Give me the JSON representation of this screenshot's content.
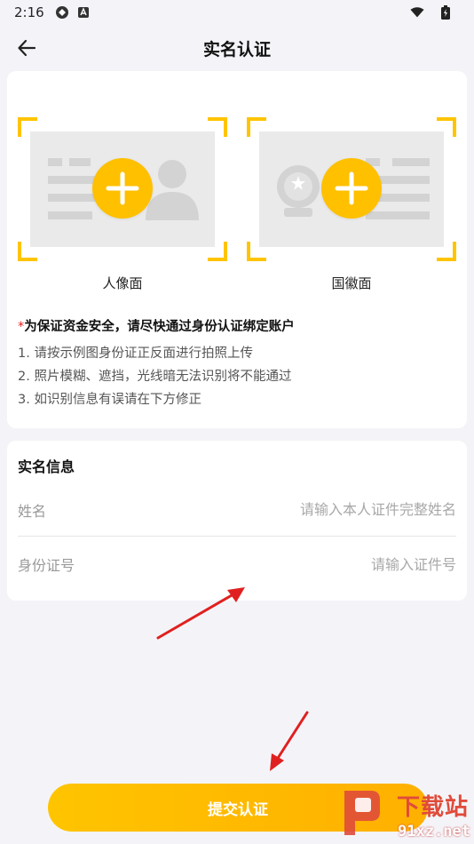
{
  "status_bar": {
    "time": "2:16"
  },
  "header": {
    "title": "实名认证"
  },
  "id_upload": {
    "front_label": "人像面",
    "back_label": "国徽面"
  },
  "notice": {
    "headline_star": "*",
    "headline": "为保证资金安全，请尽快通过身份认证绑定账户",
    "rules": [
      "1. 请按示例图身份证正反面进行拍照上传",
      "2. 照片模糊、遮挡，光线暗无法识别将不能通过",
      "3. 如识别信息有误请在下方修正"
    ]
  },
  "real_name_info": {
    "title": "实名信息",
    "name_label": "姓名",
    "name_placeholder": "请输入本人证件完整姓名",
    "id_label": "身份证号",
    "id_placeholder": "请输入证件号"
  },
  "submit_label": "提交认证",
  "watermark": {
    "main": "下载站",
    "sub": "91xz.net"
  },
  "colors": {
    "accent": "#ffc000",
    "arrow": "#e02020",
    "background": "#f4f4f8"
  }
}
